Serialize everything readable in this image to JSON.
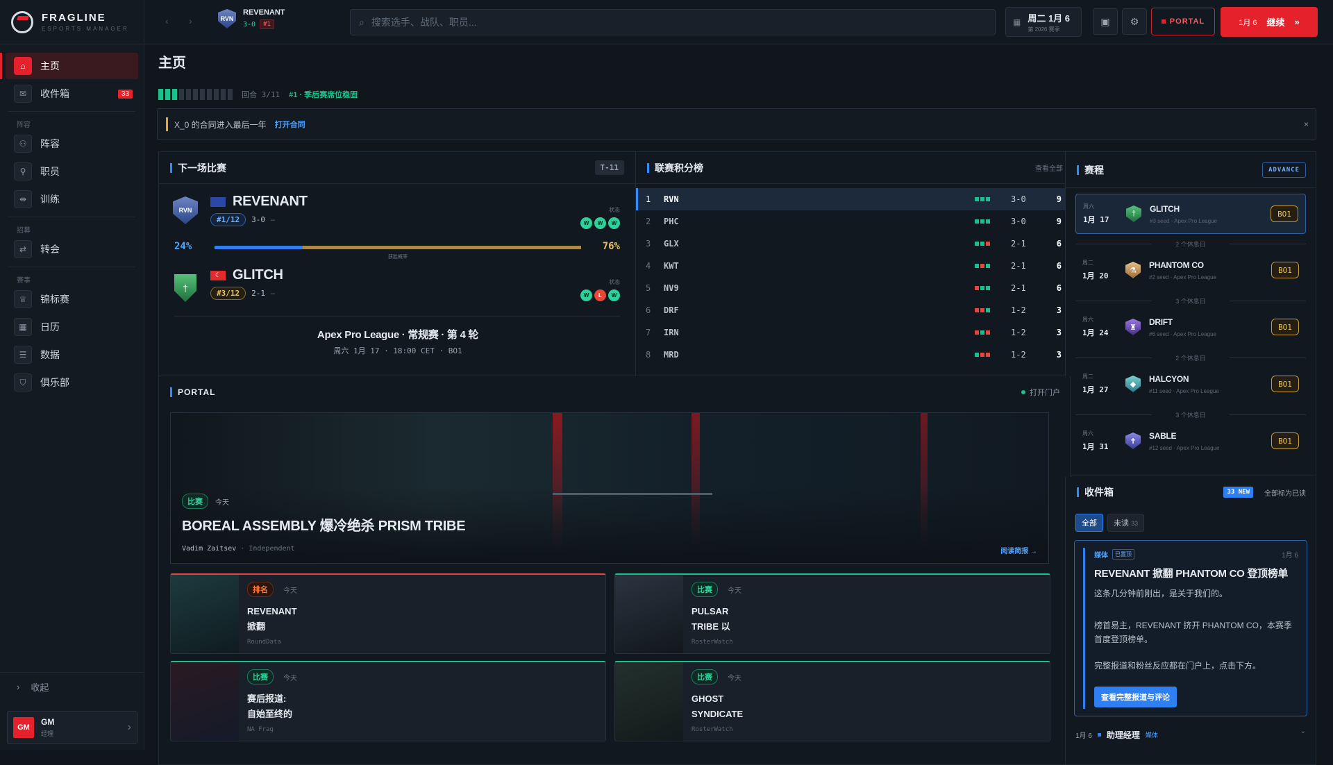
{
  "brand": {
    "name": "FRAGLINE",
    "sub": "ESPORTS MANAGER"
  },
  "sidebar": {
    "items": [
      {
        "label": "主页"
      },
      {
        "label": "收件箱",
        "badge": "33"
      }
    ],
    "sections": [
      {
        "title": "阵容",
        "items": [
          {
            "label": "阵容"
          },
          {
            "label": "职员"
          },
          {
            "label": "训练"
          }
        ]
      },
      {
        "title": "招募",
        "items": [
          {
            "label": "转会"
          }
        ]
      },
      {
        "title": "赛事",
        "items": [
          {
            "label": "锦标赛"
          },
          {
            "label": "日历"
          },
          {
            "label": "数据"
          },
          {
            "label": "俱乐部"
          }
        ]
      }
    ],
    "collapse_label": "收起",
    "user": {
      "avatar": "GM",
      "name": "GM",
      "role": "经理"
    }
  },
  "topbar": {
    "team": {
      "name": "REVENANT",
      "record": "3-0",
      "rank": "#1",
      "abbr": "RVN"
    },
    "search_placeholder": "搜索选手、战队、职员...",
    "date": {
      "main": "周二 1月 6",
      "sub": "第 2026 赛季"
    },
    "portal_label": "PORTAL",
    "continue": {
      "date": "1月 6",
      "label": "继续"
    }
  },
  "page": {
    "title": "主页",
    "progress": {
      "filled": 3,
      "total": 11,
      "text": "回合 3/11",
      "status": "#1 · 季后赛席位稳固"
    },
    "alert": {
      "text": "X_0 的合同进入最后一年",
      "link": "打开合同"
    }
  },
  "next_match": {
    "title": "下一场比赛",
    "countdown": "T-11",
    "home": {
      "abbr": "RVN",
      "name": "REVENANT",
      "seed": "#1/12",
      "record": "3-0",
      "form": [
        "W",
        "W",
        "W"
      ],
      "form_label": "状态"
    },
    "away": {
      "name": "GLITCH",
      "seed": "#3/12",
      "record": "2-1",
      "form": [
        "W",
        "L",
        "W"
      ],
      "form_label": "状态"
    },
    "home_pct": "24%",
    "away_pct": "76%",
    "win_prob": 0.24,
    "prob_label": "获胜概率",
    "league": "Apex Pro League · 常规赛 · 第 4 轮",
    "time": "周六 1月 17 · 18:00 CET · BO1"
  },
  "standings": {
    "title": "联赛积分榜",
    "view_all": "查看全部",
    "rows": [
      {
        "rank": "1",
        "team": "RVN",
        "form": [
          "W",
          "W",
          "W"
        ],
        "record": "3-0",
        "pts": "9"
      },
      {
        "rank": "2",
        "team": "PHC",
        "form": [
          "W",
          "W",
          "W"
        ],
        "record": "3-0",
        "pts": "9"
      },
      {
        "rank": "3",
        "team": "GLX",
        "form": [
          "W",
          "W",
          "L"
        ],
        "record": "2-1",
        "pts": "6"
      },
      {
        "rank": "4",
        "team": "KWT",
        "form": [
          "W",
          "L",
          "W"
        ],
        "record": "2-1",
        "pts": "6"
      },
      {
        "rank": "5",
        "team": "NV9",
        "form": [
          "L",
          "W",
          "W"
        ],
        "record": "2-1",
        "pts": "6"
      },
      {
        "rank": "6",
        "team": "DRF",
        "form": [
          "L",
          "L",
          "W"
        ],
        "record": "1-2",
        "pts": "3"
      },
      {
        "rank": "7",
        "team": "IRN",
        "form": [
          "L",
          "W",
          "L"
        ],
        "record": "1-2",
        "pts": "3"
      },
      {
        "rank": "8",
        "team": "MRD",
        "form": [
          "W",
          "L",
          "L"
        ],
        "record": "1-2",
        "pts": "3"
      }
    ]
  },
  "schedule": {
    "title": "赛程",
    "advance": "ADVANCE",
    "items": [
      {
        "day": "周六",
        "date": "1月 17",
        "team": "GLITCH",
        "meta": "#3 seed · Apex Pro League",
        "bo": "BO1"
      },
      {
        "day": "周二",
        "date": "1月 20",
        "team": "PHANTOM CO",
        "meta": "#2 seed · Apex Pro League",
        "bo": "BO1"
      },
      {
        "day": "周六",
        "date": "1月 24",
        "team": "DRIFT",
        "meta": "#6 seed · Apex Pro League",
        "bo": "BO1"
      },
      {
        "day": "周二",
        "date": "1月 27",
        "team": "HALCYON",
        "meta": "#11 seed · Apex Pro League",
        "bo": "BO1"
      },
      {
        "day": "周六",
        "date": "1月 31",
        "team": "SABLE",
        "meta": "#12 seed · Apex Pro League",
        "bo": "BO1"
      }
    ],
    "rests": [
      "2 个休息日",
      "3 个休息日",
      "2 个休息日",
      "3 个休息日"
    ]
  },
  "portal": {
    "title": "PORTAL",
    "open": "打开门户",
    "featured": {
      "category": "比赛",
      "when": "今天",
      "headline": "BOREAL ASSEMBLY 爆冷绝杀 PRISM TRIBE",
      "author": "Vadim Zaitsev",
      "outlet": "Independent",
      "read": "阅读简报 →"
    },
    "tiles": [
      {
        "category": "排名",
        "when": "今天",
        "line1": "REVENANT",
        "line2": "掀翻",
        "source": "RoundData"
      },
      {
        "category": "比赛",
        "when": "今天",
        "line1": "PULSAR",
        "line2": "TRIBE 以",
        "source": "RosterWatch"
      },
      {
        "category": "比赛",
        "when": "今天",
        "line1": "赛后报道:",
        "line2": "自始至终的",
        "source": "NA Frag"
      },
      {
        "category": "比赛",
        "when": "今天",
        "line1": "GHOST",
        "line2": "SYNDICATE",
        "source": "RosterWatch"
      }
    ]
  },
  "inbox": {
    "title": "收件箱",
    "new_badge": "33 NEW",
    "mark_all": "全部标为已读",
    "tabs": [
      {
        "label": "全部"
      },
      {
        "label": "未读",
        "count": "33"
      }
    ],
    "message": {
      "category": "媒体",
      "status": "已置顶",
      "date": "1月 6",
      "title": "REVENANT 掀翻 PHANTOM CO 登顶榜单",
      "p1": "这条几分钟前刚出，是关于我们的。",
      "p2": "榜首易主，REVENANT 挤开 PHANTOM CO，本赛季首度登顶榜单。",
      "p3": "完整报道和粉丝反应都在门户上，点击下方。",
      "cta": "查看完整报道与评论"
    },
    "next": {
      "date": "1月 6",
      "from": "助理经理",
      "tag": "媒体"
    }
  },
  "colors": {
    "accent": "#e5212b",
    "blue": "#2d8cff",
    "green": "#19c28d",
    "gold": "#c29a3a"
  }
}
